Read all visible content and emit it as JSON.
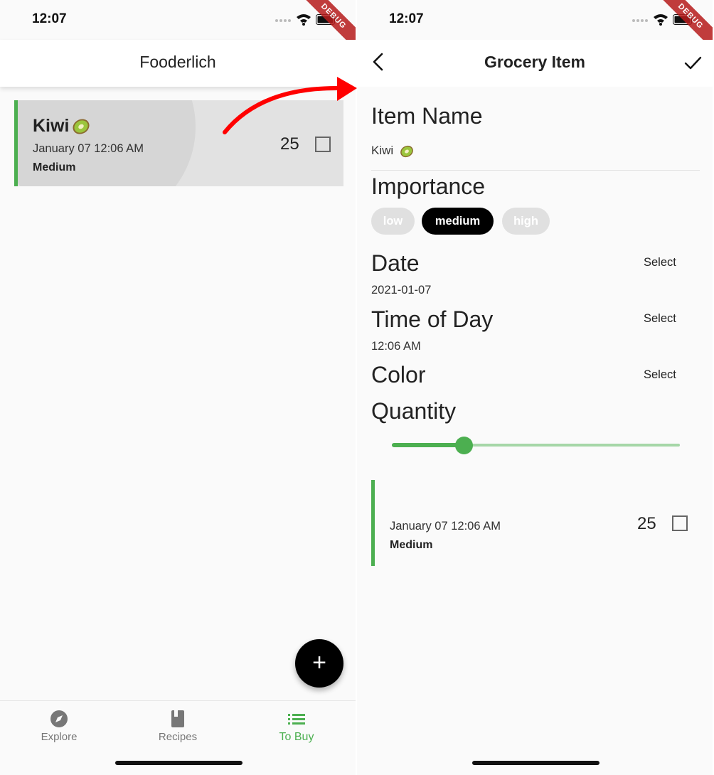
{
  "left_screen": {
    "status": {
      "time": "12:07"
    },
    "debug_label": "DEBUG",
    "app_bar": {
      "title": "Fooderlich"
    },
    "item": {
      "name": "Kiwi",
      "date": "January 07 12:06 AM",
      "importance": "Medium",
      "quantity": "25"
    },
    "fab_label": "+",
    "nav": [
      {
        "label": "Explore",
        "icon": "compass-icon"
      },
      {
        "label": "Recipes",
        "icon": "book-icon"
      },
      {
        "label": "To Buy",
        "icon": "list-icon",
        "active": true
      }
    ]
  },
  "right_screen": {
    "status": {
      "time": "12:07"
    },
    "debug_label": "DEBUG",
    "app_bar": {
      "title": "Grocery Item"
    },
    "name_section": {
      "heading": "Item Name",
      "value": "Kiwi"
    },
    "importance_section": {
      "heading": "Importance",
      "chips": [
        "low",
        "medium",
        "high"
      ],
      "selected": "medium"
    },
    "date_section": {
      "heading": "Date",
      "value": "2021-01-07",
      "button": "Select"
    },
    "time_section": {
      "heading": "Time of Day",
      "value": "12:06 AM",
      "button": "Select"
    },
    "color_section": {
      "heading": "Color",
      "button": "Select"
    },
    "quantity_section": {
      "heading": "Quantity",
      "slider_fraction": 0.25
    },
    "preview": {
      "date": "January 07 12:06 AM",
      "importance": "Medium",
      "quantity": "25"
    }
  },
  "colors": {
    "accent_green": "#4caf50",
    "annotation_arrow": "#ff0000",
    "selected_chip": "#000000"
  }
}
